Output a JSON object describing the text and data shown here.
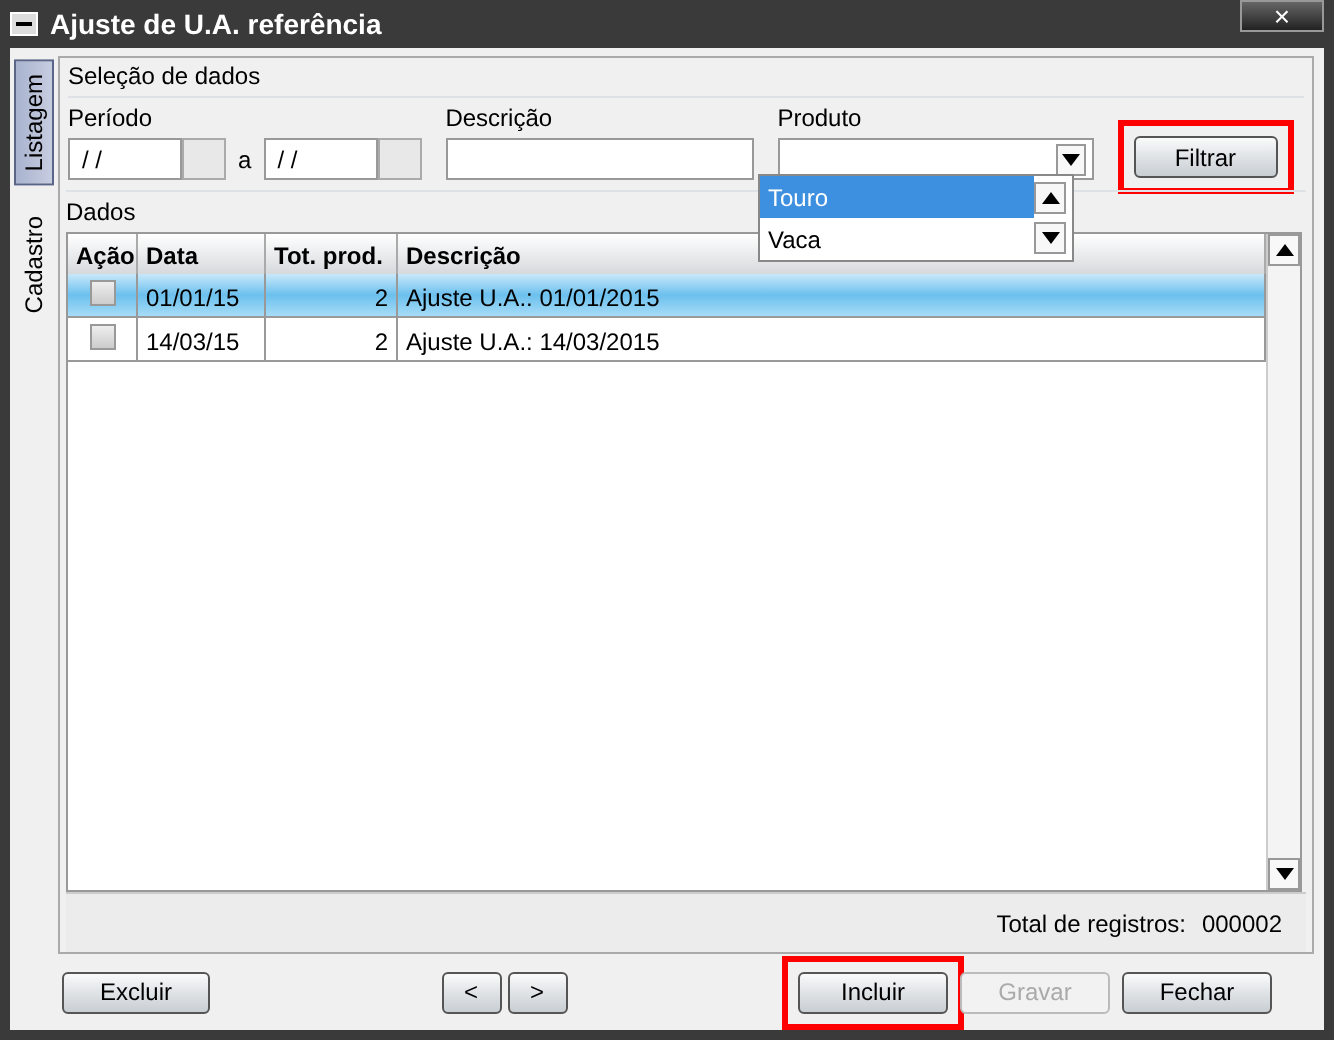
{
  "window": {
    "title": "Ajuste de U.A. referência",
    "close": "×"
  },
  "side_tabs": [
    {
      "label": "Listagem",
      "selected": true
    },
    {
      "label": "Cadastro",
      "selected": false
    }
  ],
  "selection": {
    "title": "Seleção de dados",
    "period": {
      "label": "Período",
      "from": "/ /",
      "separator": "a",
      "to": "/ /"
    },
    "description": {
      "label": "Descrição"
    },
    "product": {
      "label": "Produto",
      "expanded": true,
      "options": [
        {
          "label": "Touro",
          "selected": true
        },
        {
          "label": "Vaca",
          "selected": false
        }
      ]
    },
    "filter_button": {
      "label": "Filtrar",
      "highlighted": true
    }
  },
  "data": {
    "title": "Dados",
    "columns": [
      "Ação",
      "Data",
      "Tot. prod.",
      "Descrição"
    ],
    "rows": [
      {
        "checked": false,
        "selected": true,
        "date": "01/01/15",
        "total": "2",
        "description": "Ajuste U.A.: 01/01/2015"
      },
      {
        "checked": false,
        "selected": false,
        "date": "14/03/15",
        "total": "2",
        "description": "Ajuste U.A.: 14/03/2015"
      }
    ],
    "total_label": "Total de registros:",
    "total_value": "000002"
  },
  "buttons": [
    {
      "label": "Excluir",
      "kind": "left",
      "disabled": false,
      "highlighted": false
    },
    {
      "label": "<",
      "kind": "nav",
      "disabled": false,
      "highlighted": false
    },
    {
      "label": ">",
      "kind": "nav",
      "disabled": false,
      "highlighted": false
    },
    {
      "label": "Incluir",
      "kind": "right",
      "disabled": false,
      "highlighted": true
    },
    {
      "label": "Gravar",
      "kind": "right",
      "disabled": true,
      "highlighted": false
    },
    {
      "label": "Fechar",
      "kind": "right",
      "disabled": false,
      "highlighted": false
    }
  ]
}
